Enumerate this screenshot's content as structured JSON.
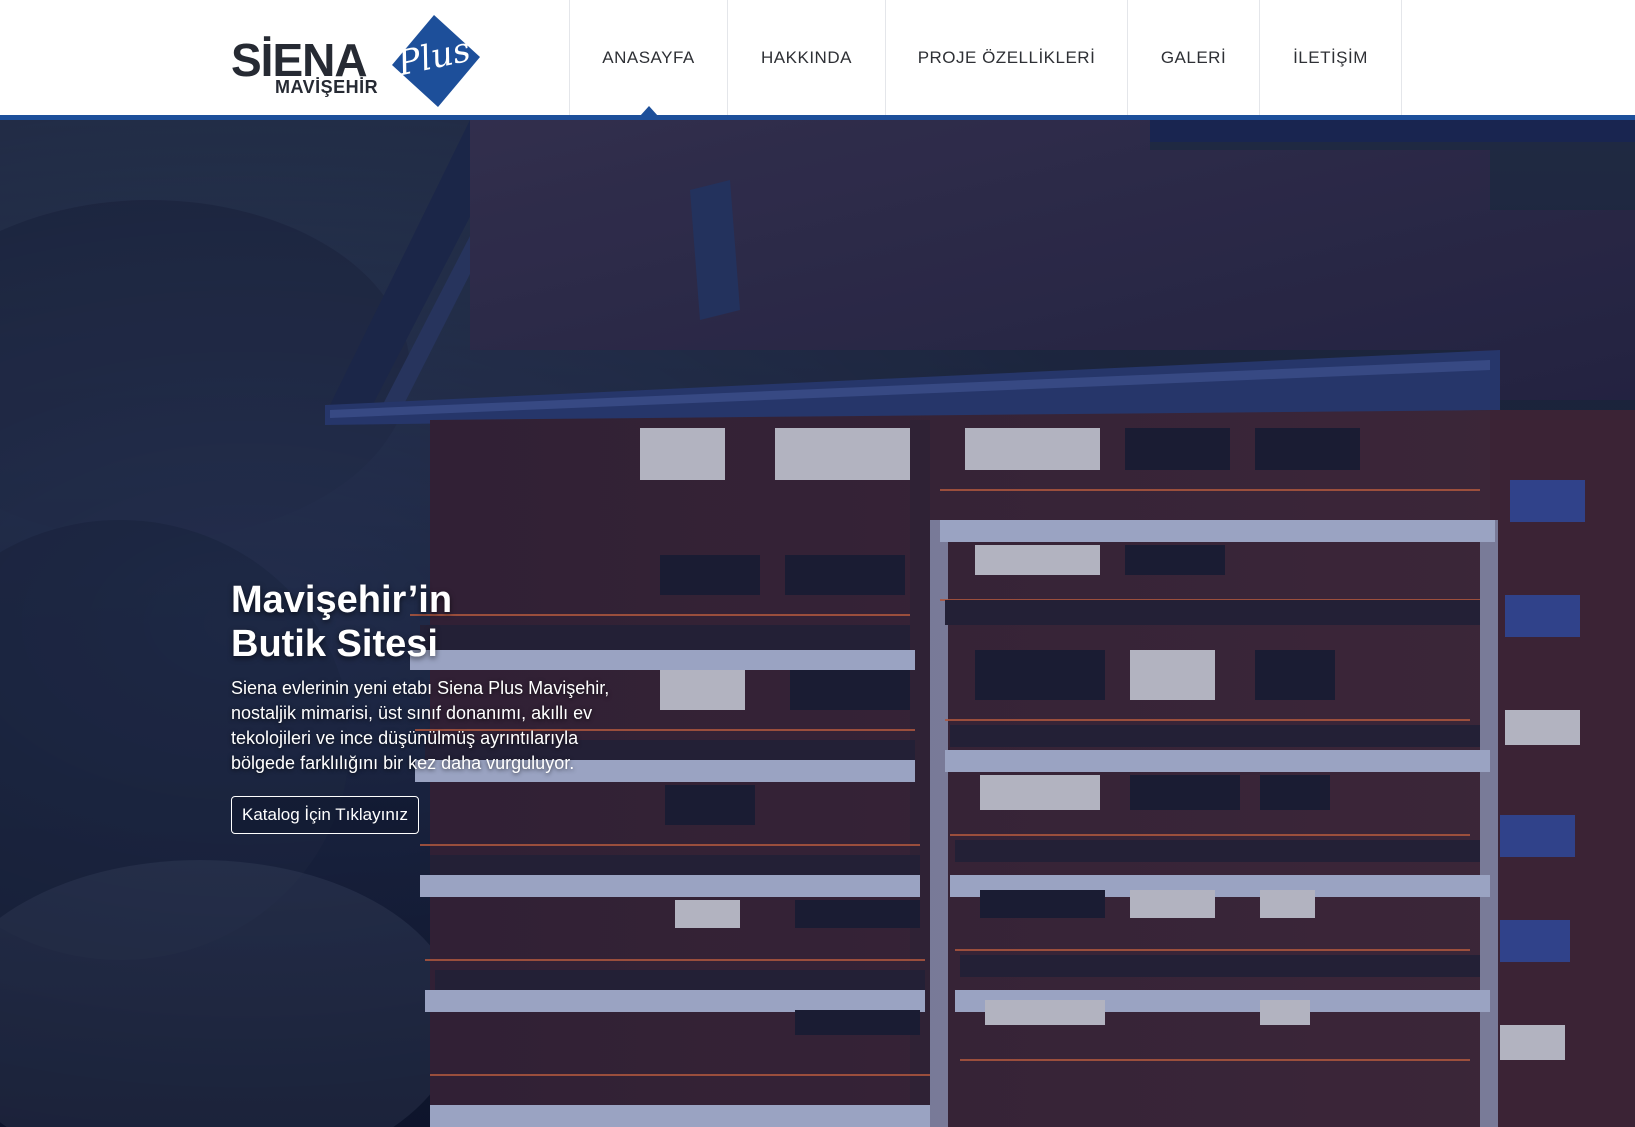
{
  "brand": {
    "name": "SİENA",
    "badge": "Plus",
    "subtitle": "MAVİŞEHİR",
    "accent_color": "#1d4f9a"
  },
  "nav": {
    "items": [
      {
        "label": "ANASAYFA",
        "active": true
      },
      {
        "label": "HAKKINDA"
      },
      {
        "label": "PROJE ÖZELLİKLERİ"
      },
      {
        "label": "GALERİ"
      },
      {
        "label": "İLETİŞİM"
      }
    ]
  },
  "hero": {
    "title_line1": "Mavişehir’in",
    "title_line2": "Butik Sitesi",
    "description": "Siena evlerinin yeni etabı Siena Plus Mavişehir, nostaljik mimarisi, üst sınıf donanımı, akıllı ev tekolojileri ve ince düşünülmüş ayrıntılarıyla bölgede farklılığını bir kez daha vurguluyor.",
    "cta_label": "Katalog İçin Tıklayınız",
    "background": "night render of apartment building"
  }
}
